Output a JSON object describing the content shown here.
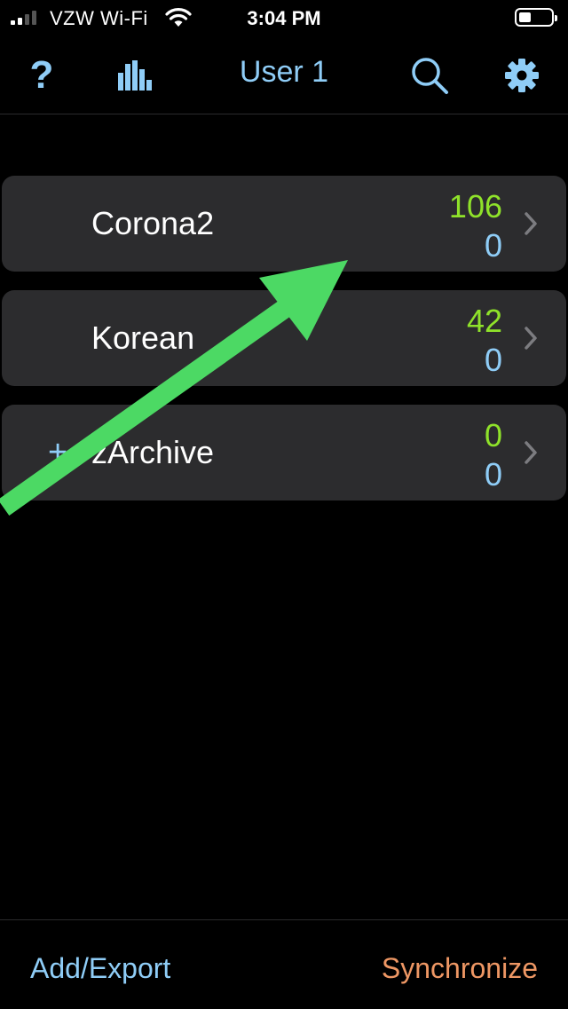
{
  "status_bar": {
    "carrier": "VZW Wi-Fi",
    "time": "3:04 PM"
  },
  "nav": {
    "title": "User 1",
    "help_label": "?",
    "icons": [
      "help-icon",
      "stats-icon",
      "search-icon",
      "gear-icon"
    ]
  },
  "decks": [
    {
      "name": "Corona2",
      "new_count": "106",
      "due_count": "0",
      "expandable": false
    },
    {
      "name": "Korean",
      "new_count": "42",
      "due_count": "0",
      "expandable": false
    },
    {
      "name": "zArchive",
      "new_count": "0",
      "due_count": "0",
      "expandable": true,
      "expand_label": "+"
    }
  ],
  "toolbar": {
    "add_export_label": "Add/Export",
    "sync_label": "Synchronize"
  },
  "colors": {
    "accent_blue": "#8fcdf7",
    "new_green": "#8fe22a",
    "sync_orange": "#ee9764",
    "row_bg": "#2c2c2e",
    "annotation_arrow": "#4cd964"
  }
}
